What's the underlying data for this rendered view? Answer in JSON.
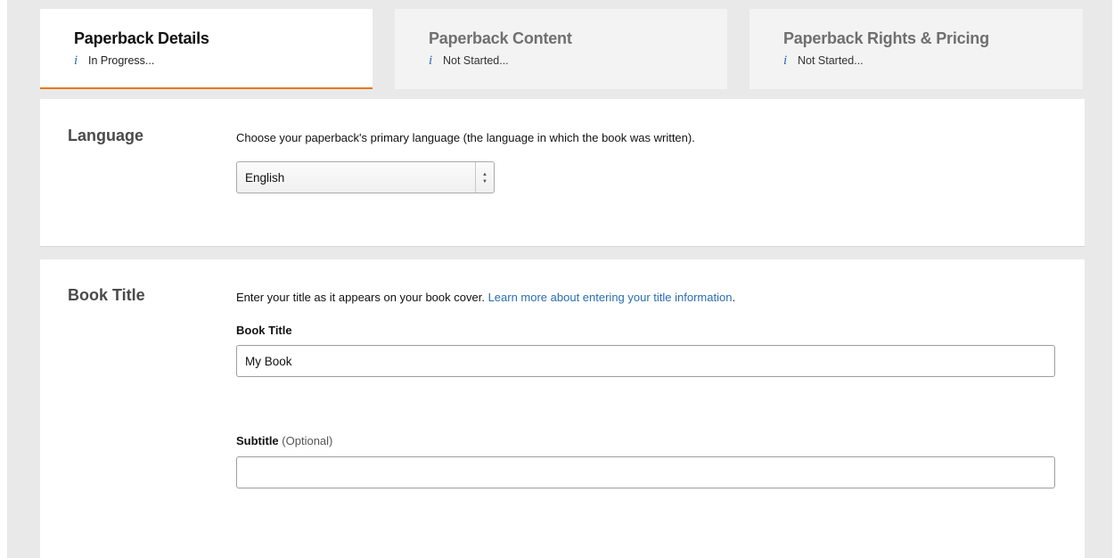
{
  "tabs": [
    {
      "title": "Paperback Details",
      "status": "In Progress..."
    },
    {
      "title": "Paperback Content",
      "status": "Not Started..."
    },
    {
      "title": "Paperback Rights & Pricing",
      "status": "Not Started..."
    }
  ],
  "language": {
    "heading": "Language",
    "description": "Choose your paperback's primary language (the language in which the book was written).",
    "selected": "English"
  },
  "book_title": {
    "heading": "Book Title",
    "description": "Enter your title as it appears on your book cover.",
    "link_text": "Learn more about entering your title information",
    "link_suffix": ".",
    "title_label": "Book Title",
    "title_value": "My Book",
    "subtitle_label": "Subtitle",
    "subtitle_optional": "(Optional)",
    "subtitle_value": ""
  },
  "colors": {
    "accent": "#e47911",
    "link": "#2a6db1"
  }
}
